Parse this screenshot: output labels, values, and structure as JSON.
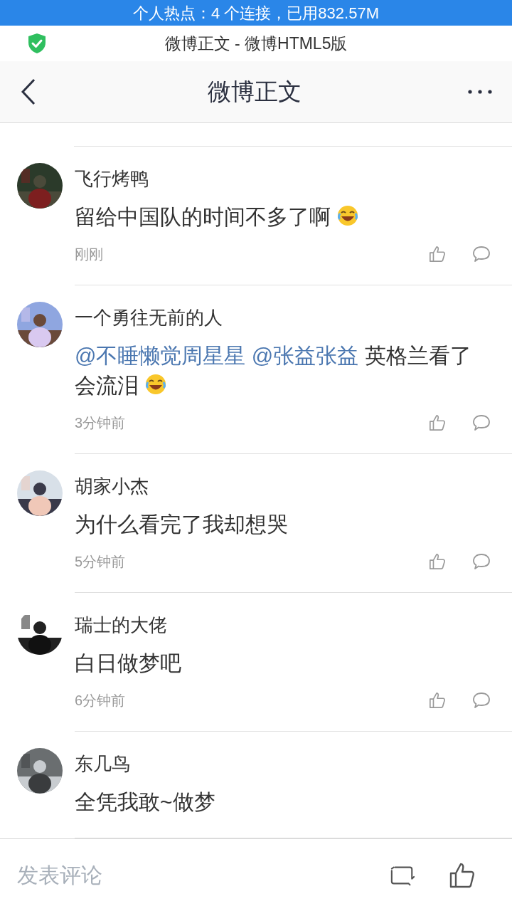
{
  "hotspot_banner": "个人热点：4 个连接，已用832.57M",
  "browser": {
    "title": "微博正文 - 微博HTML5版"
  },
  "nav": {
    "title": "微博正文"
  },
  "comments": [
    {
      "name": "飞行烤鸭",
      "content": [
        {
          "kind": "text",
          "text": "留给中国队的时间不多了啊"
        },
        {
          "kind": "emoji"
        }
      ],
      "time": "刚刚"
    },
    {
      "name": "一个勇往无前的人",
      "content": [
        {
          "kind": "mention",
          "text": "@不睡懒觉周星星"
        },
        {
          "kind": "mention",
          "text": "@张益张益"
        },
        {
          "kind": "text",
          "text": "英格兰看了会流泪"
        },
        {
          "kind": "emoji"
        }
      ],
      "time": "3分钟前"
    },
    {
      "name": "胡家小杰",
      "content": [
        {
          "kind": "text",
          "text": "为什么看完了我却想哭"
        }
      ],
      "time": "5分钟前"
    },
    {
      "name": "瑞士的大佬",
      "content": [
        {
          "kind": "text",
          "text": "白日做梦吧"
        }
      ],
      "time": "6分钟前"
    },
    {
      "name": "东几鸟",
      "content": [
        {
          "kind": "text",
          "text": "全凭我敢~做梦"
        }
      ]
    }
  ],
  "bottom_bar": {
    "placeholder": "发表评论"
  }
}
